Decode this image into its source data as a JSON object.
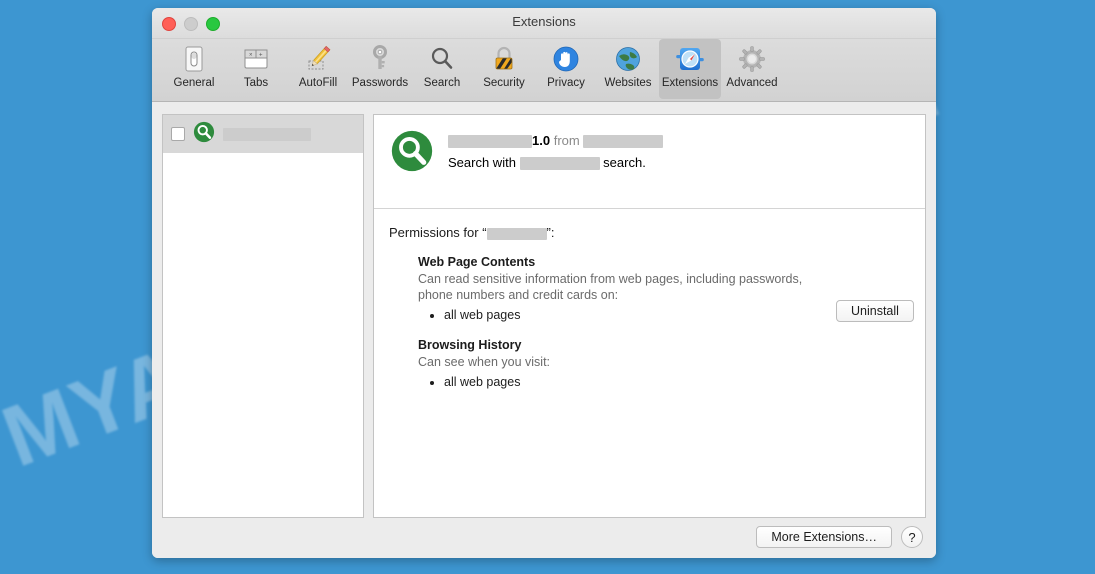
{
  "watermark": {
    "text": "MYANTISPYWARE.COM"
  },
  "window": {
    "title": "Extensions",
    "traffic_lights": {
      "close": "close-button",
      "minimize": "minimize-button",
      "zoom": "zoom-button"
    }
  },
  "toolbar": {
    "items": [
      {
        "label": "General",
        "icon": "general-icon",
        "selected": false
      },
      {
        "label": "Tabs",
        "icon": "tabs-icon",
        "selected": false
      },
      {
        "label": "AutoFill",
        "icon": "autofill-icon",
        "selected": false
      },
      {
        "label": "Passwords",
        "icon": "passwords-icon",
        "selected": false
      },
      {
        "label": "Search",
        "icon": "search-icon",
        "selected": false
      },
      {
        "label": "Security",
        "icon": "security-icon",
        "selected": false
      },
      {
        "label": "Privacy",
        "icon": "privacy-icon",
        "selected": false
      },
      {
        "label": "Websites",
        "icon": "websites-icon",
        "selected": false
      },
      {
        "label": "Extensions",
        "icon": "extensions-icon",
        "selected": true
      },
      {
        "label": "Advanced",
        "icon": "advanced-icon",
        "selected": false
      }
    ]
  },
  "extension_list": {
    "rows": [
      {
        "checked": false,
        "icon": "green-magnifier-icon",
        "name_redacted": true,
        "name": ""
      }
    ]
  },
  "detail": {
    "icon": "green-magnifier-icon",
    "name_redacted": true,
    "name": "",
    "version": "1.0",
    "from_label": "from",
    "vendor_redacted": true,
    "vendor": "",
    "description_prefix": "Search with",
    "description_suffix": "search.",
    "uninstall_label": "Uninstall"
  },
  "permissions": {
    "title_prefix": "Permissions for “",
    "title_suffix": "”:",
    "name_redacted": true,
    "groups": [
      {
        "heading": "Web Page Contents",
        "description": "Can read sensitive information from web pages, including passwords, phone numbers and credit cards on:",
        "items": [
          "all web pages"
        ]
      },
      {
        "heading": "Browsing History",
        "description": "Can see when you visit:",
        "items": [
          "all web pages"
        ]
      }
    ]
  },
  "footer": {
    "more_extensions_label": "More Extensions…",
    "help_label": "?"
  },
  "colors": {
    "desktop": "#3d96d1",
    "window_bg": "#ececec",
    "toolbar_bg": "#d6d6d6",
    "selected_tab": "#c2c2c2",
    "extension_green": "#2e8b3d",
    "close_red": "#ff5f57",
    "min_grey": "#cdcdcd",
    "zoom_green": "#28c840",
    "redaction_grey": "#cccccc"
  }
}
